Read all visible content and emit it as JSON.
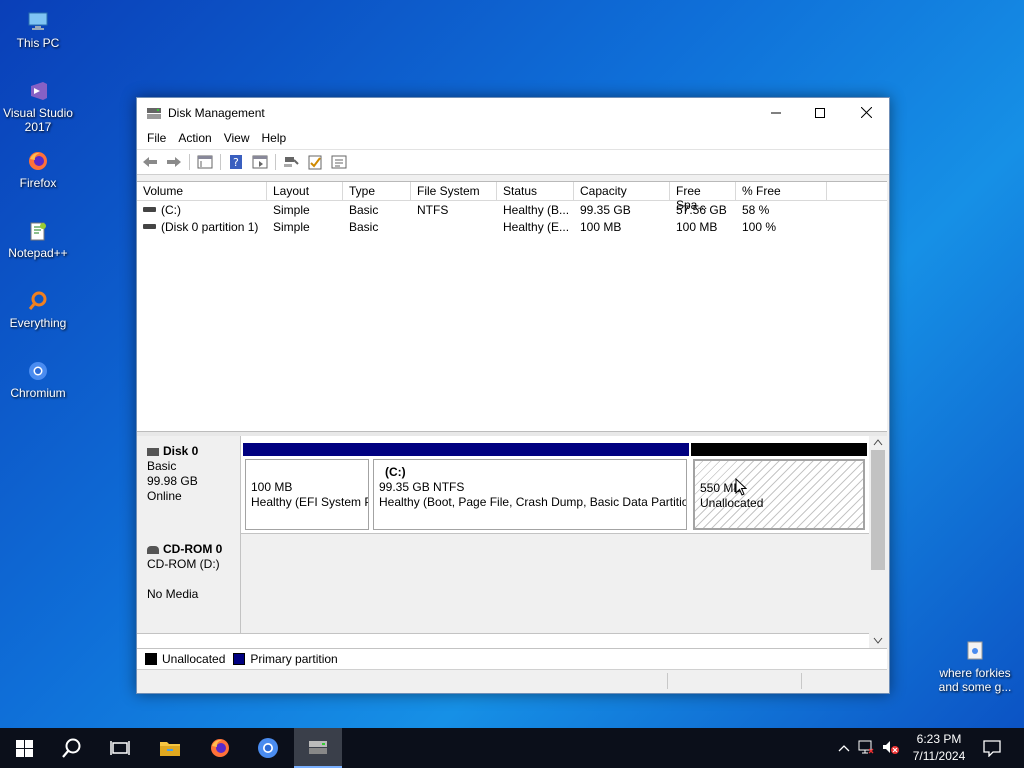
{
  "desktop": {
    "icons": [
      {
        "label": "This PC",
        "icon": "this-pc-icon"
      },
      {
        "label": "Visual Studio 2017",
        "icon": "visual-studio-icon"
      },
      {
        "label": "Firefox",
        "icon": "firefox-icon"
      },
      {
        "label": "Notepad++",
        "icon": "notepadpp-icon"
      },
      {
        "label": "Everything",
        "icon": "everything-icon"
      },
      {
        "label": "Chromium",
        "icon": "chromium-icon"
      }
    ],
    "right_icon": {
      "label": "where forkies and some g...",
      "icon": "document-icon"
    }
  },
  "window": {
    "title": "Disk Management",
    "menu": [
      "File",
      "Action",
      "View",
      "Help"
    ],
    "columns": [
      "Volume",
      "Layout",
      "Type",
      "File System",
      "Status",
      "Capacity",
      "Free Spa...",
      "% Free"
    ],
    "volumes": [
      {
        "volume": "(C:)",
        "layout": "Simple",
        "type": "Basic",
        "fs": "NTFS",
        "status": "Healthy (B...",
        "capacity": "99.35 GB",
        "free": "57.56 GB",
        "pct": "58 %"
      },
      {
        "volume": "(Disk 0 partition 1)",
        "layout": "Simple",
        "type": "Basic",
        "fs": "",
        "status": "Healthy (E...",
        "capacity": "100 MB",
        "free": "100 MB",
        "pct": "100 %"
      }
    ],
    "disk0": {
      "name": "Disk 0",
      "type": "Basic",
      "size": "99.98 GB",
      "state": "Online",
      "partitions": [
        {
          "title": "",
          "size": "100 MB",
          "status": "Healthy (EFI System Partition)"
        },
        {
          "title": "(C:)",
          "size": "99.35 GB NTFS",
          "status": "Healthy (Boot, Page File, Crash Dump, Basic Data Partition)"
        },
        {
          "title": "",
          "size": "550 MB",
          "status": "Unallocated"
        }
      ]
    },
    "cdrom": {
      "name": "CD-ROM 0",
      "type": "CD-ROM (D:)",
      "state": "No Media"
    },
    "legend": {
      "unallocated": "Unallocated",
      "primary": "Primary partition"
    }
  },
  "taskbar": {
    "clock_time": "6:23 PM",
    "clock_date": "7/11/2024"
  },
  "colors": {
    "primary_partition": "#000080",
    "unallocated": "#000000",
    "accent": "#0078d7"
  }
}
